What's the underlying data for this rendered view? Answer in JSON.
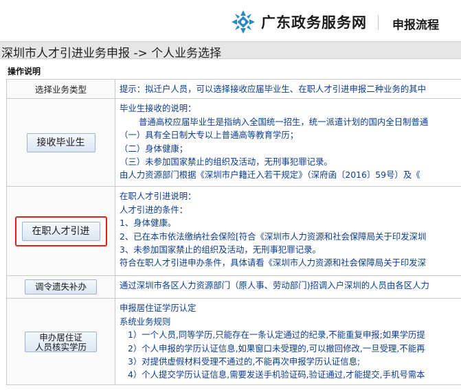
{
  "header": {
    "brand_name": "广东政务服务网",
    "nav_link": "申报流程",
    "logo_icon": "gd-gov-service-logo-icon",
    "brand_color": "#2a88c8"
  },
  "page_title": "深圳市人才引进业务申报 -> 个人业务选择",
  "section_label": "操作说明",
  "table": {
    "col_header_left": "选择业务类型",
    "col_header_right": "提示：拟迁户人员，可以选择接收应届毕业生、在职人才引进申报二种业务的其中",
    "rows": [
      {
        "button": "接收毕业生",
        "lines": [
          "毕业生接收的说明：",
          "普通高校应届毕业生是指纳入全国统一招生，统一派遣计划的国内全日制普通",
          "（一）具有全日制大专以上普通高等教育学历；",
          "（二）身体健康；",
          "（三）未参加国家禁止的组织及活动，无刑事犯罪记录。",
          "由人力资源部门根据《深圳市户籍迁入若干规定》（深府函〔2016〕59号）及《"
        ]
      },
      {
        "button": "在职人才引进",
        "lines": [
          "在职人才引进说明：",
          "人才引进的条件：",
          "1、身体健康。",
          "2、已在本市依法缴纳社会保险[符合《深圳市人力资源和社会保障局关于印发深圳",
          "3、未参加国家禁止的组织及活动，无刑事犯罪记录。",
          "符合在职人才引进申办条件，具体请看《深圳市人力资源和社会保障局关于印发深"
        ]
      },
      {
        "button": "调令遗失补办",
        "lines": [
          "通过深圳市各区人力资源部门（原人事、劳动部门)招调入户深圳的人员由各区人力"
        ]
      },
      {
        "button_line1": "申办居住证",
        "button_line2": "人员核实学历",
        "lines": [
          "申报居住证学历认定",
          "系统业务规则",
          "1）一个人员,同等学历,只能存在一条认定通过的纪录,不能重复申报;如果学历提",
          "2）个人申报的学历认证信息,如果窗口未受理的,可以撤回修改,一旦受理,不能再",
          "3）对提供虚假材料受理不通过的,不能再次申报学历认证信息;",
          "4）个人提交学历认证信息,需要发送手机验证码,验证通过,才能提交,手机号需本"
        ]
      }
    ]
  },
  "highlight_color": "#e3221b"
}
